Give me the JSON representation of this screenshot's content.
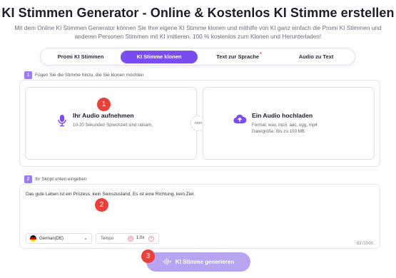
{
  "header": {
    "title": "KI Stimmen Generator - Online & Kostenlos KI Stimme erstellen",
    "subtitle": "Mit dem Online KI Stimmen Generator können Sie Ihre eigene KI Stimme klonen und mithilfe von KI ganz einfach die Promi KI Stimmen und anderen Personen Stimmen mit KI imitieren. 100 % kostenlos zum Klonen und Herunterladen!"
  },
  "tabs": [
    {
      "label": "Promi KI Stimmen",
      "active": false
    },
    {
      "label": "KI Stimme klonen",
      "active": true
    },
    {
      "label": "Text zur Sprache",
      "active": false,
      "star": "*"
    },
    {
      "label": "Audio zu Text",
      "active": false
    }
  ],
  "step1": {
    "number": "1",
    "label": "Fügen Sie die Stimme hinzu, die Sie klonen möchten",
    "record": {
      "title": "Ihr Audio aufnehmen",
      "desc": "10-20 Sekunden Sprechzeit sind ratsam."
    },
    "separator": "oder",
    "upload": {
      "title": "Ein Audio hochladen",
      "format": "Format: wav, mp3, aac, ogg, mp4",
      "size": "Dateigröße: Bis zu 100 MB"
    }
  },
  "step2": {
    "number": "2",
    "label": "Ihr Skript unten eingeben",
    "script_text": "Das gute Leben ist ein Prozess, kein Seinszustand. Es ist eine Richtung, kein Ziel.",
    "language": "German(DE)",
    "tempo_label": "Tempo",
    "tempo_value": "1.0x",
    "counter": "83 /1000"
  },
  "generate": {
    "label": "KI Stimme generieren"
  },
  "badges": [
    "1",
    "2",
    "3"
  ],
  "colors": {
    "accent": "#7b4df0",
    "button_disabled": "#b7a4f3",
    "badge": "#ea3f3a",
    "step_box": "#9a7cf2"
  },
  "icons": {
    "record": "microphone-icon",
    "upload": "cloud-upload-icon",
    "flag": "german-flag-icon",
    "generate": "sound-wave-icon"
  }
}
